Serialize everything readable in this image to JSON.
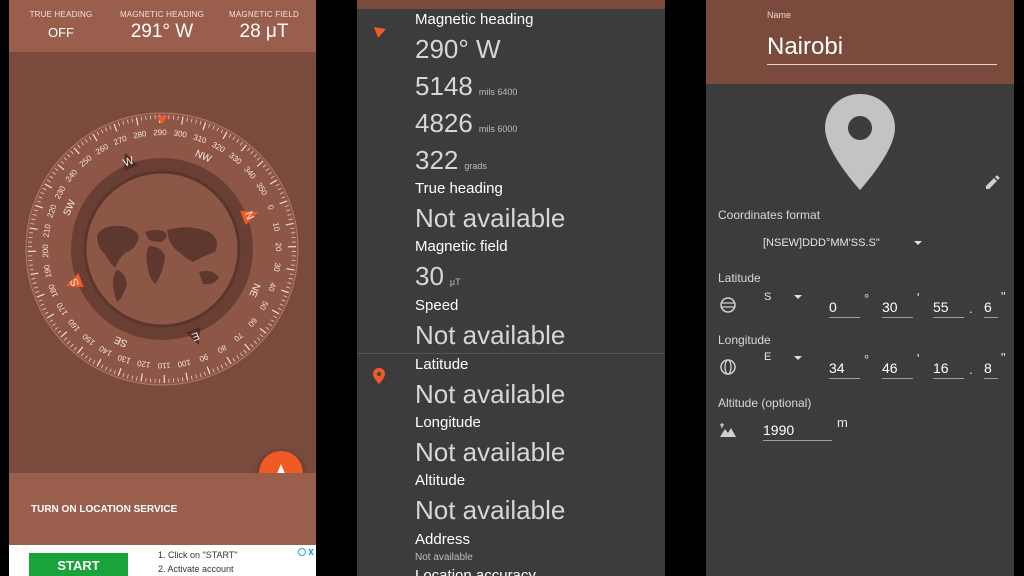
{
  "compass_screen": {
    "stats": [
      {
        "label": "TRUE HEADING",
        "value": "OFF"
      },
      {
        "label": "MAGNETIC HEADING",
        "value": "291° W"
      },
      {
        "label": "MAGNETIC FIELD",
        "value": "28 μT"
      }
    ],
    "dial": {
      "heading_deg": 291,
      "cardinals": [
        "N",
        "NE",
        "E",
        "SE",
        "S",
        "SW",
        "W",
        "NW"
      ],
      "degree_labels": [
        "0",
        "10",
        "20",
        "30",
        "40",
        "50",
        "60",
        "70",
        "80",
        "90",
        "100",
        "110",
        "120",
        "130",
        "140",
        "150",
        "160",
        "170",
        "180",
        "190",
        "200",
        "210",
        "220",
        "230",
        "240",
        "250",
        "260",
        "270",
        "280",
        "290",
        "300",
        "310",
        "320",
        "330",
        "340",
        "350"
      ]
    },
    "location_service_label": "TURN ON LOCATION SERVICE",
    "ad": {
      "button_label": "START",
      "line1": "1. Click on \"START\"",
      "line2": "2. Activate account"
    }
  },
  "details_screen": {
    "magnetic_heading_label": "Magnetic heading",
    "magnetic_heading_value": "290° W",
    "mils6400_value": "5148",
    "mils6400_unit": "mils 6400",
    "mils6000_value": "4826",
    "mils6000_unit": "mils 6000",
    "grads_value": "322",
    "grads_unit": "grads",
    "true_heading_label": "True heading",
    "true_heading_value": "Not available",
    "magnetic_field_label": "Magnetic field",
    "magnetic_field_value": "30",
    "magnetic_field_unit": "μT",
    "speed_label": "Speed",
    "speed_value": "Not available",
    "latitude_label": "Latitude",
    "latitude_value": "Not available",
    "longitude_label": "Longitude",
    "longitude_value": "Not available",
    "altitude_label": "Altitude",
    "altitude_value": "Not available",
    "address_label": "Address",
    "address_value": "Not available",
    "accuracy_label": "Location accuracy"
  },
  "location_edit_screen": {
    "name_label": "Name",
    "name_value": "Nairobi",
    "coord_format_label": "Coordinates format",
    "coord_format_value": "[NSEW]DDD°MM'SS.S\"",
    "latitude_label": "Latitude",
    "lat_hemisphere": "S",
    "lat_deg": "0",
    "lat_min": "30",
    "lat_sec": "55",
    "lat_tenths": "6",
    "longitude_label": "Longitude",
    "lon_hemisphere": "E",
    "lon_deg": "34",
    "lon_min": "46",
    "lon_sec": "16",
    "lon_tenths": "8",
    "deg_symbol": "°",
    "min_symbol": "'",
    "sec_symbol": "\"",
    "dot_symbol": ".",
    "altitude_label": "Altitude (optional)",
    "altitude_value": "1990",
    "altitude_unit": "m"
  },
  "colors": {
    "brown_dark": "#7a4a3c",
    "brown_light": "#9a5e4d",
    "accent_orange": "#ef5a25",
    "panel_grey": "#3c3c3c"
  }
}
